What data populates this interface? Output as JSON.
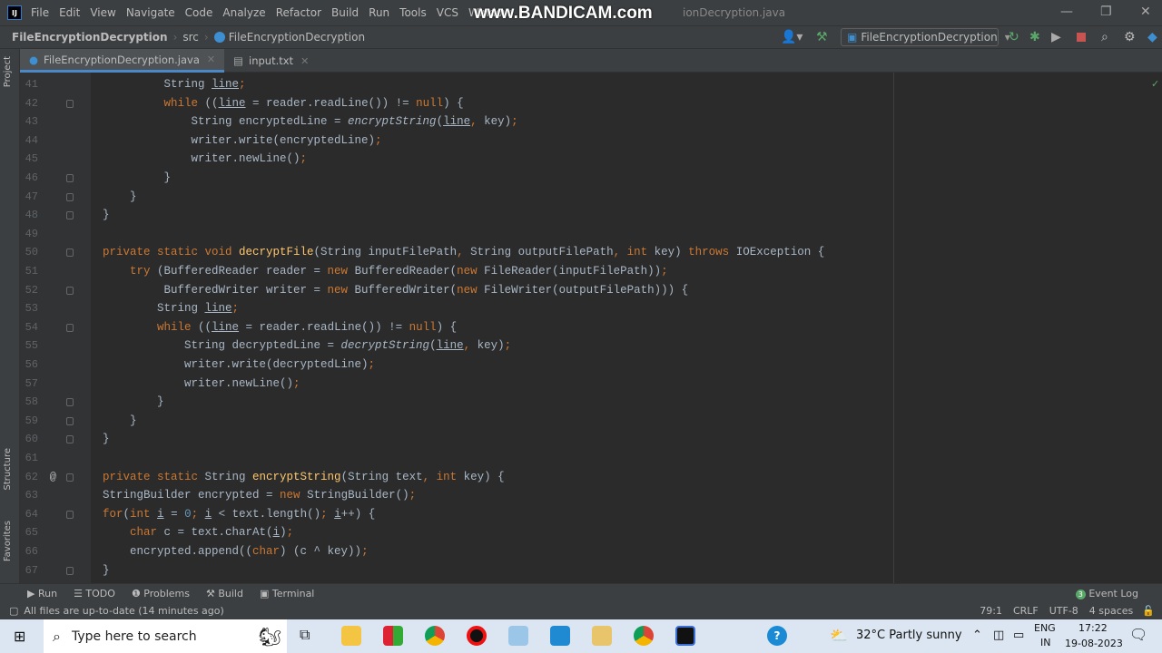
{
  "window": {
    "title_fragment": "ionDecryption.java",
    "watermark": "www.BANDICAM.com"
  },
  "menu": [
    "File",
    "Edit",
    "View",
    "Navigate",
    "Code",
    "Analyze",
    "Refactor",
    "Build",
    "Run",
    "Tools",
    "VCS",
    "Window"
  ],
  "breadcrumb": {
    "project": "FileEncryptionDecryption",
    "folder": "src",
    "class": "FileEncryptionDecryption"
  },
  "toolbar": {
    "run_config": "FileEncryptionDecryption"
  },
  "tabs": [
    {
      "label": "FileEncryptionDecryption.java",
      "active": true
    },
    {
      "label": "input.txt",
      "active": false
    }
  ],
  "side_tools": {
    "project": "Project",
    "structure": "Structure",
    "favorites": "Favorites"
  },
  "code": [
    {
      "n": "41",
      "indent": 9,
      "fold": false,
      "t": [
        [
          "String ",
          "p"
        ],
        [
          "line",
          "u"
        ],
        [
          ";",
          "k"
        ]
      ]
    },
    {
      "n": "42",
      "indent": 9,
      "fold": true,
      "t": [
        [
          "while ",
          "k"
        ],
        [
          "((",
          "p"
        ],
        [
          "line",
          "u"
        ],
        [
          " = reader.readLine()) != ",
          "p"
        ],
        [
          "null",
          "k"
        ],
        [
          ") {",
          "p"
        ]
      ]
    },
    {
      "n": "43",
      "indent": 13,
      "fold": false,
      "t": [
        [
          "String encryptedLine = ",
          "p"
        ],
        [
          "encryptString",
          "i"
        ],
        [
          "(",
          "p"
        ],
        [
          "line",
          "u"
        ],
        [
          ", ",
          "k"
        ],
        [
          "key)",
          "p"
        ],
        [
          ";",
          "k"
        ]
      ]
    },
    {
      "n": "44",
      "indent": 13,
      "fold": false,
      "t": [
        [
          "writer.write(encryptedLine)",
          "p"
        ],
        [
          ";",
          "k"
        ]
      ]
    },
    {
      "n": "45",
      "indent": 13,
      "fold": false,
      "t": [
        [
          "writer.newLine()",
          "p"
        ],
        [
          ";",
          "k"
        ]
      ]
    },
    {
      "n": "46",
      "indent": 9,
      "fold": true,
      "t": [
        [
          "}",
          "p"
        ]
      ]
    },
    {
      "n": "47",
      "indent": 4,
      "fold": true,
      "t": [
        [
          "}",
          "p"
        ]
      ]
    },
    {
      "n": "48",
      "indent": 0,
      "fold": true,
      "t": [
        [
          "}",
          "p"
        ]
      ]
    },
    {
      "n": "49",
      "indent": 0,
      "fold": false,
      "t": []
    },
    {
      "n": "50",
      "indent": 0,
      "fold": true,
      "t": [
        [
          "private static void ",
          "k"
        ],
        [
          "decryptFile",
          "f"
        ],
        [
          "(String inputFilePath",
          "p"
        ],
        [
          ", ",
          "k"
        ],
        [
          "String outputFilePath",
          "p"
        ],
        [
          ", ",
          "k"
        ],
        [
          "int ",
          "k"
        ],
        [
          "key) ",
          "p"
        ],
        [
          "throws ",
          "k"
        ],
        [
          "IOException {",
          "p"
        ]
      ]
    },
    {
      "n": "51",
      "indent": 4,
      "fold": false,
      "t": [
        [
          "try ",
          "k"
        ],
        [
          "(BufferedReader reader = ",
          "p"
        ],
        [
          "new ",
          "k"
        ],
        [
          "BufferedReader(",
          "p"
        ],
        [
          "new ",
          "k"
        ],
        [
          "FileReader(inputFilePath))",
          "p"
        ],
        [
          ";",
          "k"
        ]
      ]
    },
    {
      "n": "52",
      "indent": 9,
      "fold": true,
      "t": [
        [
          "BufferedWriter writer = ",
          "p"
        ],
        [
          "new ",
          "k"
        ],
        [
          "BufferedWriter(",
          "p"
        ],
        [
          "new ",
          "k"
        ],
        [
          "FileWriter(outputFilePath))) {",
          "p"
        ]
      ]
    },
    {
      "n": "53",
      "indent": 8,
      "fold": false,
      "t": [
        [
          "String ",
          "p"
        ],
        [
          "line",
          "u"
        ],
        [
          ";",
          "k"
        ]
      ]
    },
    {
      "n": "54",
      "indent": 8,
      "fold": true,
      "t": [
        [
          "while ",
          "k"
        ],
        [
          "((",
          "p"
        ],
        [
          "line",
          "u"
        ],
        [
          " = reader.readLine()) != ",
          "p"
        ],
        [
          "null",
          "k"
        ],
        [
          ") {",
          "p"
        ]
      ]
    },
    {
      "n": "55",
      "indent": 12,
      "fold": false,
      "t": [
        [
          "String decryptedLine = ",
          "p"
        ],
        [
          "decryptString",
          "i"
        ],
        [
          "(",
          "p"
        ],
        [
          "line",
          "u"
        ],
        [
          ", ",
          "k"
        ],
        [
          "key)",
          "p"
        ],
        [
          ";",
          "k"
        ]
      ]
    },
    {
      "n": "56",
      "indent": 12,
      "fold": false,
      "t": [
        [
          "writer.write(decryptedLine)",
          "p"
        ],
        [
          ";",
          "k"
        ]
      ]
    },
    {
      "n": "57",
      "indent": 12,
      "fold": false,
      "t": [
        [
          "writer.newLine()",
          "p"
        ],
        [
          ";",
          "k"
        ]
      ]
    },
    {
      "n": "58",
      "indent": 8,
      "fold": true,
      "t": [
        [
          "}",
          "p"
        ]
      ]
    },
    {
      "n": "59",
      "indent": 4,
      "fold": true,
      "t": [
        [
          "}",
          "p"
        ]
      ]
    },
    {
      "n": "60",
      "indent": 0,
      "fold": true,
      "t": [
        [
          "}",
          "p"
        ]
      ]
    },
    {
      "n": "61",
      "indent": 0,
      "fold": false,
      "t": []
    },
    {
      "n": "62",
      "indent": 0,
      "fold": true,
      "t": [
        [
          "private static ",
          "k"
        ],
        [
          "String ",
          "p"
        ],
        [
          "encryptString",
          "f"
        ],
        [
          "(String text",
          "p"
        ],
        [
          ", ",
          "k"
        ],
        [
          "int ",
          "k"
        ],
        [
          "key) {",
          "p"
        ]
      ]
    },
    {
      "n": "63",
      "indent": 0,
      "fold": false,
      "t": [
        [
          "StringBuilder encrypted = ",
          "p"
        ],
        [
          "new ",
          "k"
        ],
        [
          "StringBuilder()",
          "p"
        ],
        [
          ";",
          "k"
        ]
      ]
    },
    {
      "n": "64",
      "indent": 0,
      "fold": true,
      "t": [
        [
          "for",
          "k"
        ],
        [
          "(",
          "p"
        ],
        [
          "int ",
          "k"
        ],
        [
          "i",
          "u"
        ],
        [
          " = ",
          "p"
        ],
        [
          "0",
          "n"
        ],
        [
          "; ",
          "k"
        ],
        [
          "i",
          "u"
        ],
        [
          " < text.length()",
          "p"
        ],
        [
          "; ",
          "k"
        ],
        [
          "i",
          "u"
        ],
        [
          "++) {",
          "p"
        ]
      ]
    },
    {
      "n": "65",
      "indent": 4,
      "fold": false,
      "t": [
        [
          "char ",
          "k"
        ],
        [
          "c = text.charAt(",
          "p"
        ],
        [
          "i",
          "u"
        ],
        [
          ")",
          "p"
        ],
        [
          ";",
          "k"
        ]
      ]
    },
    {
      "n": "66",
      "indent": 4,
      "fold": false,
      "t": [
        [
          "encrypted.append((",
          "p"
        ],
        [
          "char",
          "k"
        ],
        [
          ") (c ^ key))",
          "p"
        ],
        [
          ";",
          "k"
        ]
      ]
    },
    {
      "n": "67",
      "indent": 0,
      "fold": true,
      "t": [
        [
          "}",
          "p"
        ]
      ]
    }
  ],
  "override_marker_line": "62",
  "bottom_tools": {
    "run": "Run",
    "todo": "TODO",
    "problems": "Problems",
    "build": "Build",
    "terminal": "Terminal",
    "event_log": "Event Log",
    "event_count": "3"
  },
  "status": {
    "message": "All files are up-to-date (14 minutes ago)",
    "position": "79:1",
    "line_sep": "CRLF",
    "encoding": "UTF-8",
    "indent": "4 spaces"
  },
  "taskbar": {
    "search_placeholder": "Type here to search",
    "weather": "32°C  Partly sunny",
    "lang1": "ENG",
    "lang2": "IN",
    "time": "17:22",
    "date": "19-08-2023"
  },
  "colors": {
    "keyword": "#cc7832",
    "function": "#ffc66d",
    "text": "#a9b7c6",
    "number": "#6897bb",
    "editor_bg": "#2b2b2b",
    "accent": "#4a88c7"
  }
}
